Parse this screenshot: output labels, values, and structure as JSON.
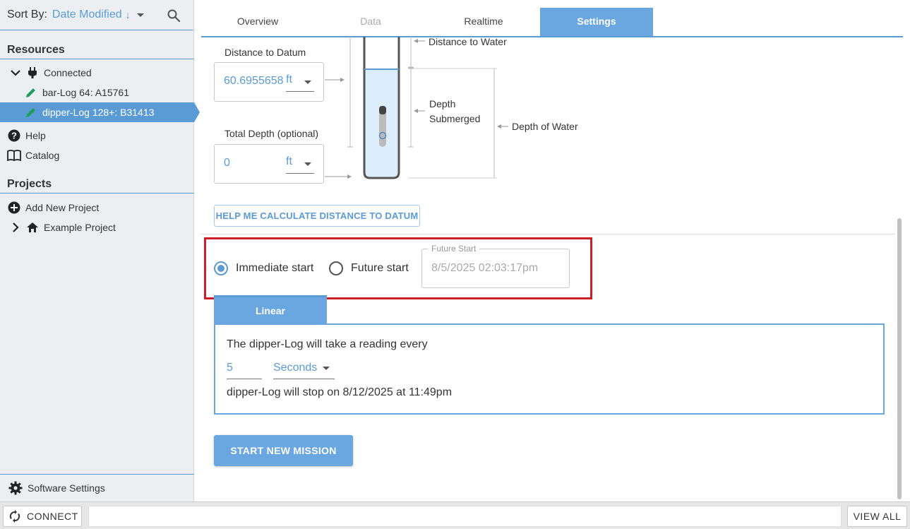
{
  "sidebar": {
    "sort_label": "Sort By:",
    "sort_value": "Date Modified",
    "sort_direction_glyph": "↓",
    "resources_title": "Resources",
    "connected_label": "Connected",
    "devices": [
      {
        "label": "bar-Log 64: A15761",
        "active": false
      },
      {
        "label": "dipper-Log 128+: B31413",
        "active": true
      }
    ],
    "help_label": "Help",
    "catalog_label": "Catalog",
    "projects_title": "Projects",
    "add_project_label": "Add New Project",
    "example_project_label": "Example Project",
    "software_settings_label": "Software Settings"
  },
  "bottombar": {
    "connect_label": "CONNECT",
    "status_text": "",
    "view_all_label": "VIEW ALL"
  },
  "tabs": [
    {
      "label": "Overview",
      "state": "normal"
    },
    {
      "label": "Data",
      "state": "disabled"
    },
    {
      "label": "Realtime",
      "state": "normal"
    },
    {
      "label": "Settings",
      "state": "active"
    }
  ],
  "datum": {
    "distance_label": "Distance to Datum",
    "distance_value": "60.6955658",
    "distance_unit": "ft",
    "total_depth_label": "Total Depth (optional)",
    "total_depth_value": "0",
    "total_depth_unit": "ft",
    "help_button_label": "HELP ME CALCULATE DISTANCE TO DATUM"
  },
  "diagram": {
    "distance_to_water": "Distance to Water",
    "depth_submerged_line1": "Depth",
    "depth_submerged_line2": "Submerged",
    "depth_of_water": "Depth of Water"
  },
  "start": {
    "immediate_label": "Immediate start",
    "future_label": "Future start",
    "selected": "immediate",
    "future_start_legend": "Future Start",
    "future_start_value": "8/5/2025 02:03:17pm"
  },
  "schedule": {
    "mode_tab": "Linear",
    "reading_text": "The dipper-Log will take a reading every",
    "interval_value": "5",
    "interval_unit": "Seconds",
    "stop_text": "dipper-Log will stop on 8/12/2025 at 11:49pm"
  },
  "start_mission_label": "START NEW MISSION",
  "colors": {
    "accent": "#5b9bd5",
    "accent_fill": "#6aa6e0",
    "highlight": "#cc1f27",
    "sidebar_bg": "#eceff1",
    "device_icon": "#1e9e5a"
  }
}
